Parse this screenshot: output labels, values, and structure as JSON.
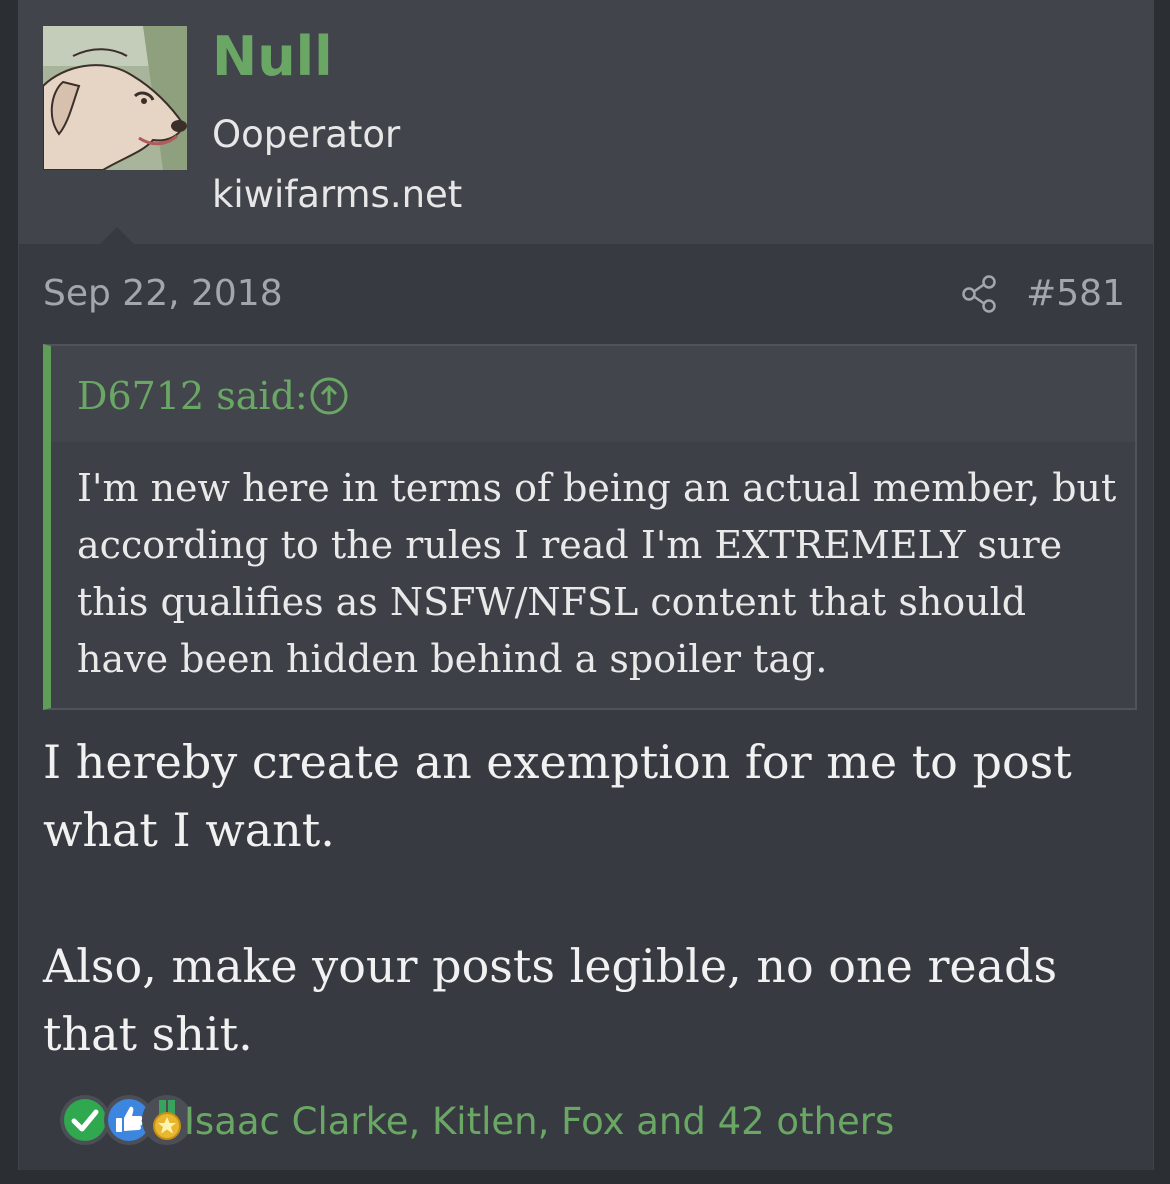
{
  "user": {
    "name": "Null",
    "title": "Ooperator",
    "site": "kiwifarms.net"
  },
  "post": {
    "date": "Sep 22, 2018",
    "number": "#581"
  },
  "quote": {
    "author": "D6712 said:",
    "text": "I'm new here in terms of being an actual member, but according to the rules I read I'm EXTREMELY sure this qualifies as NSFW/NFSL content that should have been hidden behind a spoiler tag."
  },
  "message": {
    "line1": "I hereby create an exemption for me to post what I want.",
    "line2": "Also, make your posts legible, no one reads that shit."
  },
  "reactions": {
    "icons": [
      "check-icon",
      "thumbs-up-icon",
      "medal-icon"
    ],
    "summary": "Isaac Clarke, Kitlen, Fox and 42 others"
  },
  "colors": {
    "accent": "#6aa765",
    "background": "#373a40",
    "header": "#41444a",
    "quote_bar": "#5f9e58"
  }
}
